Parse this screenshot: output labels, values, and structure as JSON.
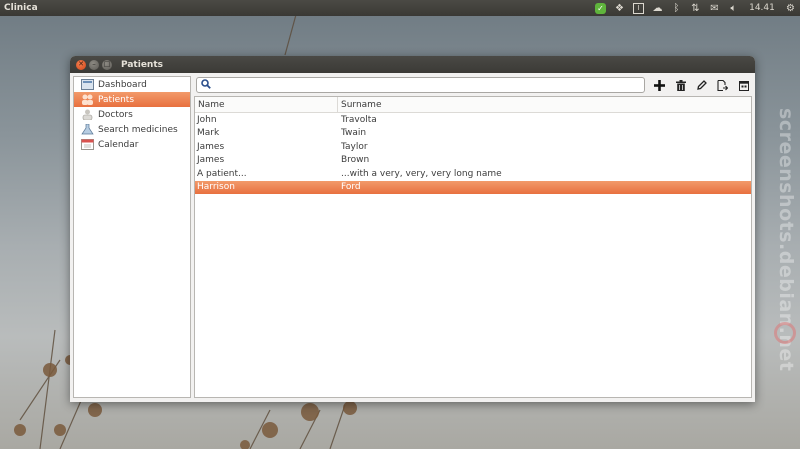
{
  "topbar": {
    "app_title": "Clinica",
    "clock": "14.41"
  },
  "window": {
    "title": "Patients"
  },
  "sidebar": {
    "items": [
      {
        "label": "Dashboard"
      },
      {
        "label": "Patients"
      },
      {
        "label": "Doctors"
      },
      {
        "label": "Search medicines"
      },
      {
        "label": "Calendar"
      }
    ]
  },
  "search": {
    "value": "",
    "placeholder": ""
  },
  "table": {
    "columns": [
      "Name",
      "Surname"
    ],
    "rows": [
      [
        "John",
        "Travolta"
      ],
      [
        "Mark",
        "Twain"
      ],
      [
        "James",
        "Taylor"
      ],
      [
        "James",
        "Brown"
      ],
      [
        "A patient...",
        "...with a very, very, very long name"
      ],
      [
        "Harrison",
        "Ford"
      ]
    ]
  },
  "watermark": "screenshots.debian.net",
  "colors": {
    "accent": "#e8703f",
    "panel": "#3c3b37"
  }
}
